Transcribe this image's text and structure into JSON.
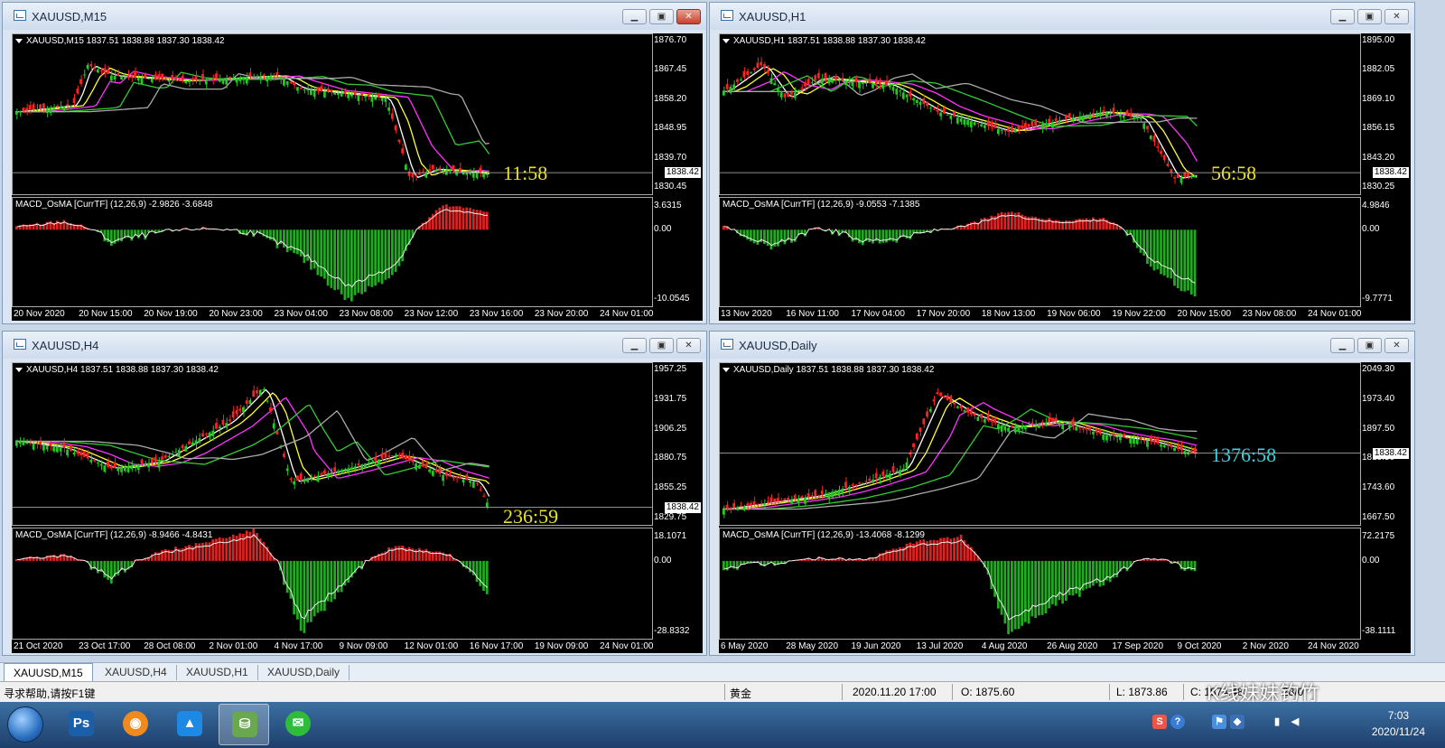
{
  "windows": [
    {
      "id": "m15",
      "title": "XAUUSD,M15",
      "header": "XAUUSD,M15  1837.51 1838.88 1837.30 1838.42",
      "price_labels": [
        "1876.70",
        "1867.45",
        "1858.20",
        "1848.95",
        "1839.70",
        "1830.45"
      ],
      "current_price": "1838.42",
      "timer": "11:58",
      "timer_color": "#e8e030",
      "macd_header": "MACD_OsMA [CurrTF] (12,26,9) -2.9826 -3.6848",
      "macd_labels": [
        "3.6315",
        "0.00",
        "-10.0545"
      ],
      "time_labels": [
        "20 Nov 2020",
        "20 Nov 15:00",
        "20 Nov 19:00",
        "20 Nov 23:00",
        "23 Nov 04:00",
        "23 Nov 08:00",
        "23 Nov 12:00",
        "23 Nov 16:00",
        "23 Nov 20:00",
        "24 Nov 01:00"
      ]
    },
    {
      "id": "h1",
      "title": "XAUUSD,H1",
      "header": "XAUUSD,H1  1837.51 1838.88 1837.30 1838.42",
      "price_labels": [
        "1895.00",
        "1882.05",
        "1869.10",
        "1856.15",
        "1843.20",
        "1830.25"
      ],
      "current_price": "1838.42",
      "timer": "56:58",
      "timer_color": "#e8e030",
      "macd_header": "MACD_OsMA [CurrTF] (12,26,9) -9.0553 -7.1385",
      "macd_labels": [
        "4.9846",
        "0.00",
        "-9.7771"
      ],
      "time_labels": [
        "13 Nov 2020",
        "16 Nov 11:00",
        "17 Nov 04:00",
        "17 Nov 20:00",
        "18 Nov 13:00",
        "19 Nov 06:00",
        "19 Nov 22:00",
        "20 Nov 15:00",
        "23 Nov 08:00",
        "24 Nov 01:00"
      ]
    },
    {
      "id": "h4",
      "title": "XAUUSD,H4",
      "header": "XAUUSD,H4  1837.51 1838.88 1837.30 1838.42",
      "price_labels": [
        "1957.25",
        "1931.75",
        "1906.25",
        "1880.75",
        "1855.25",
        "1829.75"
      ],
      "current_price": "1838.42",
      "timer": "236:59",
      "timer_color": "#e8e030",
      "macd_header": "MACD_OsMA [CurrTF] (12,26,9) -8.9466 -4.8431",
      "macd_labels": [
        "18.1071",
        "0.00",
        "-28.8332"
      ],
      "time_labels": [
        "21 Oct 2020",
        "23 Oct 17:00",
        "28 Oct 08:00",
        "2 Nov 01:00",
        "4 Nov 17:00",
        "9 Nov 09:00",
        "12 Nov 01:00",
        "16 Nov 17:00",
        "19 Nov 09:00",
        "24 Nov 01:00"
      ]
    },
    {
      "id": "d1",
      "title": "XAUUSD,Daily",
      "header": "XAUUSD,Daily  1837.51 1838.88 1837.30 1838.42",
      "price_labels": [
        "2049.30",
        "1973.40",
        "1897.50",
        "1819.50",
        "1743.60",
        "1667.50"
      ],
      "current_price": "1838.42",
      "timer": "1376:58",
      "timer_color": "#40d0d8",
      "macd_header": "MACD_OsMA [CurrTF] (12,26,9) -13.4068 -8.1299",
      "macd_labels": [
        "72.2175",
        "0.00",
        "-38.1111"
      ],
      "time_labels": [
        "6 May 2020",
        "28 May 2020",
        "19 Jun 2020",
        "13 Jul 2020",
        "4 Aug 2020",
        "26 Aug 2020",
        "17 Sep 2020",
        "9 Oct 2020",
        "2 Nov 2020",
        "24 Nov 2020"
      ]
    }
  ],
  "tabs": [
    "XAUUSD,M15",
    "XAUUSD,H4",
    "XAUUSD,H1",
    "XAUUSD,Daily"
  ],
  "status": {
    "help": "寻求帮助,请按F1键",
    "symbol": "黄金",
    "datetime": "2020.11.20 17:00",
    "open": "O: 1875.60",
    "low": "L: 1873.86",
    "close": "C: 1874.48",
    "extra": "28/0"
  },
  "taskbar": {
    "apps": [
      {
        "name": "ps",
        "label": "Ps",
        "color": "#1b5fa8"
      },
      {
        "name": "browser",
        "label": "◉",
        "color": "#f08a1e"
      },
      {
        "name": "cloud",
        "label": "▲",
        "color": "#1e88e5"
      },
      {
        "name": "mt4",
        "label": "⛁",
        "color": "#6aa84f"
      },
      {
        "name": "wechat",
        "label": "✉",
        "color": "#2dbd3a"
      }
    ],
    "time": "7:03",
    "date": "2020/11/24"
  },
  "watermark": "K线妹妹钓竹"
}
